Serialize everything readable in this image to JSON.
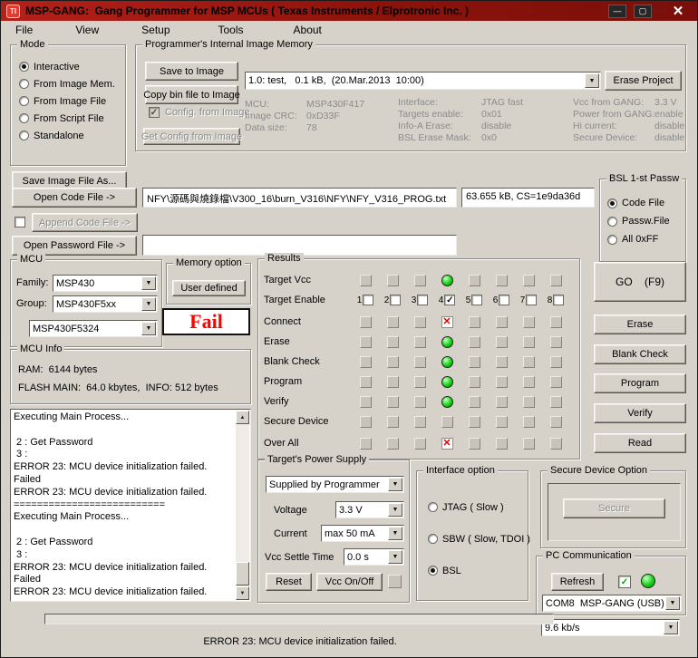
{
  "colors": {
    "titlebar_red": "#8c130c",
    "window_gray": "#d6d2ca",
    "led_green": "#12d412",
    "error_red": "#e40000",
    "fail_red": "#ff0000"
  },
  "icons": {
    "ti_logo": "TI",
    "minimize": "—",
    "maximize": "▢",
    "close": "✕",
    "dropdown": "▼",
    "scroll_up": "▲",
    "scroll_down": "▼",
    "check": "✓",
    "red_x": "✕"
  },
  "window": {
    "title": "MSP-GANG:  Gang Programmer for MSP MCUs ( Texas Instruments / Elprotronic Inc. )"
  },
  "menu": {
    "items": [
      "File",
      "View",
      "Setup",
      "Tools",
      "About"
    ]
  },
  "mode": {
    "title": "Mode",
    "options": [
      {
        "label": "Interactive",
        "selected": true
      },
      {
        "label": "From Image Mem.",
        "selected": false
      },
      {
        "label": "From Image File",
        "selected": false
      },
      {
        "label": "From Script File",
        "selected": false
      },
      {
        "label": "Standalone",
        "selected": false
      }
    ]
  },
  "image_memory": {
    "title": "Programmer's Internal Image Memory",
    "save_to_image": "Save to Image",
    "copy_bin": "Copy bin file to Image",
    "image_select": "1.0: test,   0.1 kB,  (20.Mar.2013  10:00)",
    "erase_project": "Erase Project",
    "config_from_image": "Config. from Image",
    "get_config": "Get Config from Image",
    "info_col1": [
      {
        "label": "MCU:",
        "value": "MSP430F417"
      },
      {
        "label": "Image CRC:",
        "value": "0xD33F"
      },
      {
        "label": "Data size:",
        "value": "78"
      }
    ],
    "info_col2": [
      {
        "label": "Interface:",
        "value": "JTAG fast"
      },
      {
        "label": "Targets enable:",
        "value": "0x01"
      },
      {
        "label": "Info-A Erase:",
        "value": "disable"
      },
      {
        "label": "BSL Erase Mask:",
        "value": "0x0"
      }
    ],
    "info_col3": [
      {
        "label": "Vcc from GANG:",
        "value": "3.3 V"
      },
      {
        "label": "Power from GANG:",
        "value": "enable"
      },
      {
        "label": "Hi current:",
        "value": "disable"
      },
      {
        "label": "Secure Device:",
        "value": "disable"
      }
    ]
  },
  "files": {
    "save_image_as": "Save Image File As...",
    "open_code": "Open Code File ->",
    "code_path": "NFY\\源碼與燒錄檔\\V300_16\\burn_V316\\NFY\\NFY_V316_PROG.txt",
    "code_size": "63.655 kB, CS=1e9da36d",
    "append_code": "Append Code File ->",
    "open_password": "Open Password File ->",
    "password_path": ""
  },
  "bsl_passw": {
    "title": "BSL 1-st Passw",
    "options": [
      {
        "label": "Code File",
        "selected": true
      },
      {
        "label": "Passw.File",
        "selected": false
      },
      {
        "label": "All 0xFF",
        "selected": false
      }
    ]
  },
  "mcu": {
    "title": "MCU",
    "family_label": "Family:",
    "family": "MSP430",
    "group_label": "Group:",
    "group": "MSP430F5xx",
    "device": "MSP430F5324",
    "memory_option_title": "Memory option",
    "memory_option_button": "User defined",
    "fail_text": "Fail"
  },
  "mcu_info": {
    "title": "MCU Info",
    "line1": "RAM:  6144 bytes",
    "line2": "FLASH MAIN:  64.0 kbytes,  INFO: 512 bytes"
  },
  "log": {
    "lines": [
      "Executing Main Process...",
      "",
      " 2 : Get Password",
      " 3 :",
      "ERROR 23: MCU device initialization failed.",
      "Failed",
      "ERROR 23: MCU device initialization failed.",
      "==========================",
      "Executing Main Process...",
      "",
      " 2 : Get Password",
      " 3 :",
      "ERROR 23: MCU device initialization failed.",
      "Failed",
      "ERROR 23: MCU device initialization failed."
    ]
  },
  "results": {
    "title": "Results",
    "rows": [
      {
        "label": "Target Vcc",
        "type": "leds",
        "cells": [
          "off",
          "off",
          "off",
          "green",
          "off",
          "off",
          "off",
          "off"
        ]
      },
      {
        "label": "Target Enable",
        "type": "checks",
        "numbers": [
          "1",
          "2",
          "3",
          "4",
          "5",
          "6",
          "7",
          "8"
        ],
        "checked": [
          false,
          false,
          false,
          true,
          false,
          false,
          false,
          false
        ]
      },
      {
        "label": "Connect",
        "type": "leds",
        "cells": [
          "off",
          "off",
          "off",
          "redx",
          "off",
          "off",
          "off",
          "off"
        ]
      },
      {
        "label": "Erase",
        "type": "leds",
        "cells": [
          "off",
          "off",
          "off",
          "green",
          "off",
          "off",
          "off",
          "off"
        ]
      },
      {
        "label": "Blank Check",
        "type": "leds",
        "cells": [
          "off",
          "off",
          "off",
          "green",
          "off",
          "off",
          "off",
          "off"
        ]
      },
      {
        "label": "Program",
        "type": "leds",
        "cells": [
          "off",
          "off",
          "off",
          "green",
          "off",
          "off",
          "off",
          "off"
        ]
      },
      {
        "label": "Verify",
        "type": "leds",
        "cells": [
          "off",
          "off",
          "off",
          "green",
          "off",
          "off",
          "off",
          "off"
        ]
      },
      {
        "label": "Secure Device",
        "type": "leds",
        "cells": [
          "off",
          "off",
          "off",
          "off",
          "off",
          "off",
          "off",
          "off"
        ]
      },
      {
        "label": "Over All",
        "type": "leds",
        "cells": [
          "off",
          "off",
          "off",
          "redx",
          "off",
          "off",
          "off",
          "off"
        ]
      }
    ]
  },
  "actions": {
    "go": "GO    (F9)",
    "erase": "Erase",
    "blank_check": "Blank Check",
    "program": "Program",
    "verify": "Verify",
    "read": "Read"
  },
  "power": {
    "title": "Target's Power Supply",
    "source": "Supplied by Programmer",
    "voltage_label": "Voltage",
    "voltage": "3.3 V",
    "current_label": "Current",
    "current": "max 50 mA",
    "settle_label": "Vcc Settle Time",
    "settle": "0.0 s",
    "reset": "Reset",
    "vcc_onoff": "Vcc On/Off"
  },
  "interface_option": {
    "title": "Interface option",
    "options": [
      {
        "label": "JTAG ( Slow )",
        "selected": false
      },
      {
        "label": "SBW ( Slow, TDOI )",
        "selected": false
      },
      {
        "label": "BSL",
        "selected": true
      }
    ]
  },
  "secure_device": {
    "title": "Secure Device Option",
    "button": "Secure"
  },
  "pc_comm": {
    "title": "PC Communication",
    "refresh": "Refresh",
    "port": "COM8  MSP-GANG (USB)",
    "baud": "9.6 kb/s"
  },
  "status": {
    "message": "ERROR 23: MCU device initialization failed."
  }
}
